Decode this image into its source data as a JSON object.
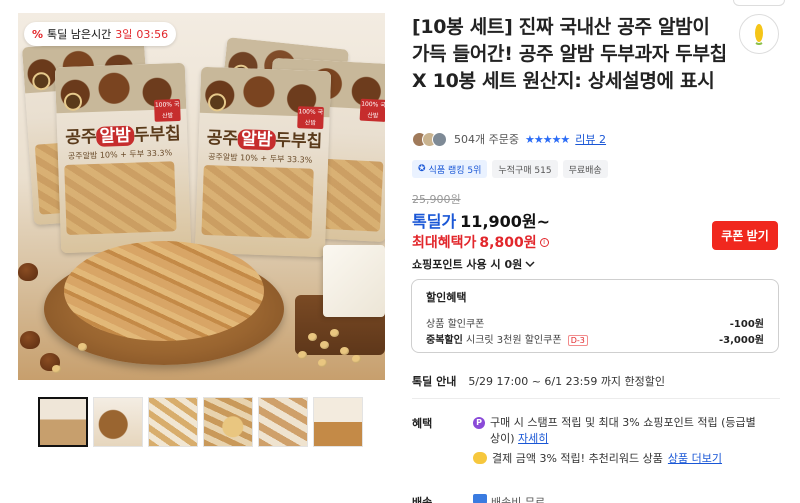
{
  "deal_timer": {
    "label": "톡딜 남은시간",
    "days": "3일",
    "time": "03:56"
  },
  "product": {
    "title": "[10봉 세트] 진짜 국내산 공주 알밤이 가득 들어간! 공주 알밤 두부과자 두부칩 X 10봉 세트 원산지: 상세설명에 표시",
    "package_brand": "공주",
    "package_name_highlight": "알밤",
    "package_name_rest": "두부칩",
    "package_sub": "공주알밤 10% + 두부 33.3%",
    "package_badge": "100% 국산밤"
  },
  "meta": {
    "order_count": "504개 주문중",
    "stars": "★★★★★",
    "review_link": "리뷰 2"
  },
  "tags": [
    {
      "label": "식품 랭킹 5위",
      "icon": "award-icon",
      "style": "blue"
    },
    {
      "label": "누적구매 515",
      "style": "gray"
    },
    {
      "label": "무료배송",
      "style": "gray"
    }
  ],
  "price": {
    "original": "25,900원",
    "sale_label": "톡딜가",
    "sale_price": "11,900원~",
    "max_benefit_label": "최대혜택가",
    "max_benefit_price": "8,800원",
    "coupon_button": "쿠폰 받기",
    "point_use": "쇼핑포인트 사용 시 0원"
  },
  "discount_box": {
    "title": "할인혜택",
    "line1_label": "상품 할인쿠폰",
    "line1_value": "-100원",
    "line2_label_bold": "중복할인",
    "line2_label": "시크릿 3천원 할인쿠폰",
    "line2_dday": "D-3",
    "line2_value": "-3,000원"
  },
  "tdeal_info": {
    "label": "톡딜 안내",
    "value": "5/29 17:00 ~ 6/1 23:59 까지 한정할인"
  },
  "benefits": {
    "label": "혜택",
    "item1_text": "구매 시 스탬프 적립 및 최대 3% 쇼핑포인트 적립 (등급별 상이)",
    "item1_link": "자세히",
    "item2_text": "결제 금액 3% 적립! 추천리워드 상품",
    "item2_link": "상품 더보기"
  },
  "shipping": {
    "label": "배송",
    "value": "배송비 무료"
  },
  "colors": {
    "accent_red": "#e2272c",
    "accent_blue": "#1a57d6",
    "coupon_red": "#f0281e"
  }
}
